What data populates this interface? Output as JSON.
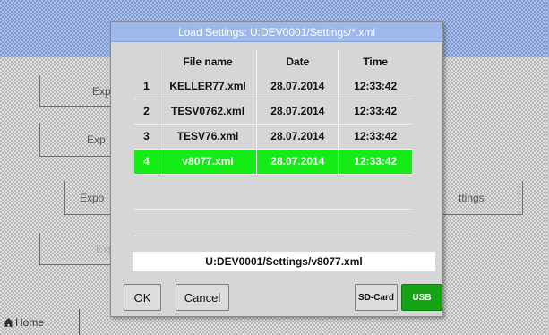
{
  "background": {
    "buttons": [
      {
        "label": "Exp"
      },
      {
        "label": "Exp"
      },
      {
        "label": "Expo"
      },
      {
        "label": "ttings"
      },
      {
        "label": "Exp"
      }
    ],
    "home_label": "Home"
  },
  "dialog": {
    "title": "Load Settings:  U:DEV0001/Settings/*.xml",
    "columns": [
      "File name",
      "Date",
      "Time"
    ],
    "rows": [
      {
        "num": "1",
        "name": "KELLER77.xml",
        "date": "28.07.2014",
        "time": "12:33:42"
      },
      {
        "num": "2",
        "name": "TESV0762.xml",
        "date": "28.07.2014",
        "time": "12:33:42"
      },
      {
        "num": "3",
        "name": "TESV76.xml",
        "date": "28.07.2014",
        "time": "12:33:42"
      },
      {
        "num": "4",
        "name": "v8077.xml",
        "date": "28.07.2014",
        "time": "12:33:42"
      }
    ],
    "selected_row": 4,
    "path": "U:DEV0001/Settings/v8077.xml",
    "ok_label": "OK",
    "cancel_label": "Cancel",
    "sdcard_label": "SD-Card",
    "usb_label": "USB"
  },
  "colors": {
    "title_bar": "#9db8ea",
    "selected_row": "#15ec15",
    "usb_active": "#13a313"
  },
  "icons": {
    "home": "home-icon"
  }
}
